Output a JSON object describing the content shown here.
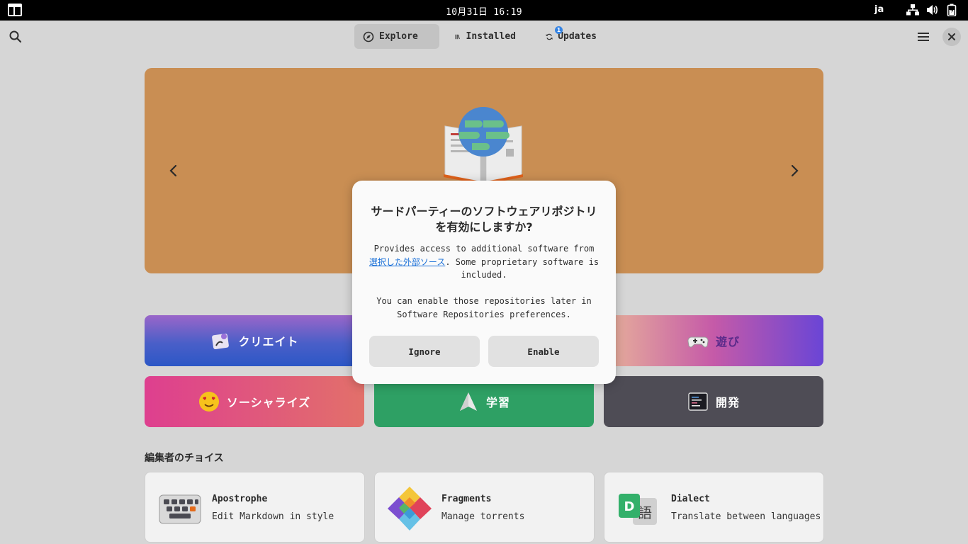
{
  "topbar": {
    "clock": "10月31日  16:19",
    "lang": "ja"
  },
  "header": {
    "tabs": [
      {
        "label": "Explore",
        "active": true
      },
      {
        "label": "Installed",
        "active": false
      },
      {
        "label": "Updates",
        "active": false
      }
    ],
    "updates_badge": "1"
  },
  "categories": [
    {
      "label": "クリエイト"
    },
    {
      "label": "遊び"
    },
    {
      "label": "ソーシャライズ"
    },
    {
      "label": "学習"
    },
    {
      "label": "開発"
    }
  ],
  "editors_choice": {
    "title": "編集者のチョイス",
    "apps": [
      {
        "name": "Apostrophe",
        "desc": "Edit Markdown in style"
      },
      {
        "name": "Fragments",
        "desc": "Manage torrents"
      },
      {
        "name": "Dialect",
        "desc": "Translate between languages"
      }
    ]
  },
  "dialog": {
    "title_line1": "サードパーティーのソフトウェアリポジトリ",
    "title_line2": "を有効にしますか?",
    "body_pre": "Provides access to additional software from ",
    "body_link": "選択した外部ソース",
    "body_post": ". Some proprietary software is included.",
    "body_2": "You can enable those repositories later in Software Repositories preferences.",
    "ignore_label": "Ignore",
    "enable_label": "Enable"
  },
  "colors": {
    "banner": "#c98e53",
    "accent": "#3584e4",
    "link": "#1c71d8"
  }
}
